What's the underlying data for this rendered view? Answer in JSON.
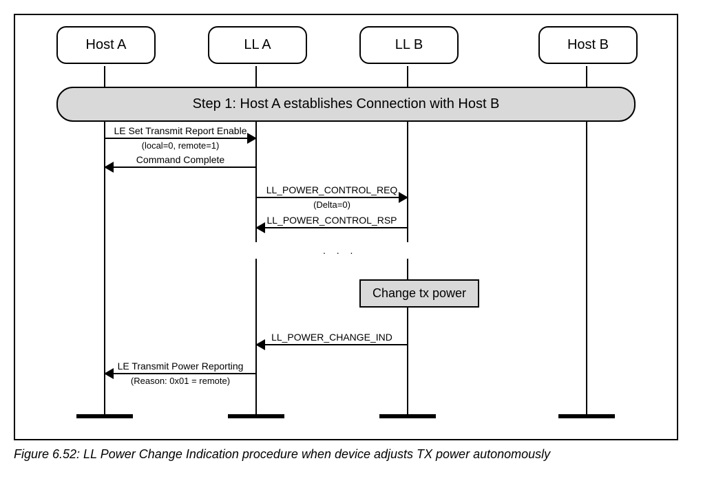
{
  "actors": {
    "hostA": "Host A",
    "llA": "LL A",
    "llB": "LL B",
    "hostB": "Host B"
  },
  "step1": "Step 1: Host A establishes Connection with Host B",
  "messages": {
    "m1": "LE Set Transmit Report Enable",
    "m1s": "(local=0, remote=1)",
    "m2": "Command Complete",
    "m3": "LL_POWER_CONTROL_REQ",
    "m3s": "(Delta=0)",
    "m4": "LL_POWER_CONTROL_RSP",
    "m5": "LL_POWER_CHANGE_IND",
    "m6": "LE Transmit Power Reporting",
    "m6s": "(Reason: 0x01 = remote)"
  },
  "ellipsis": ". . .",
  "actionBox": "Change tx power",
  "caption": "Figure 6.52:  LL Power Change Indication procedure when device adjusts TX power autonomously"
}
